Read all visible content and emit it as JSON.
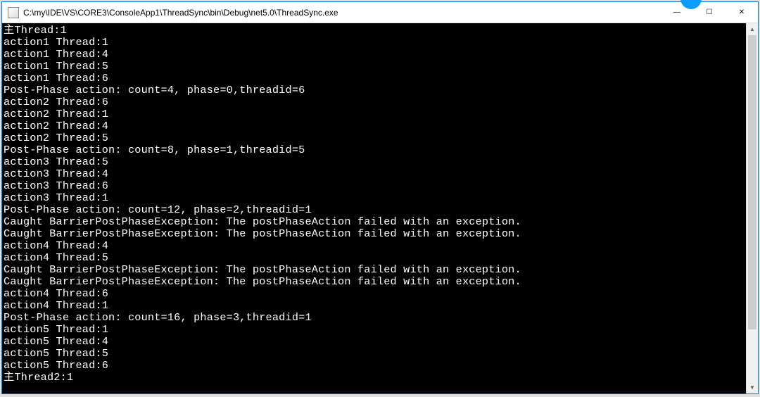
{
  "window": {
    "title": "C:\\my\\IDE\\VS\\CORE3\\ConsoleApp1\\ThreadSync\\bin\\Debug\\net5.0\\ThreadSync.exe"
  },
  "console": {
    "lines": [
      "主Thread:1",
      "action1 Thread:1",
      "action1 Thread:4",
      "action1 Thread:5",
      "action1 Thread:6",
      "Post-Phase action: count=4, phase=0,threadid=6",
      "action2 Thread:6",
      "action2 Thread:1",
      "action2 Thread:4",
      "action2 Thread:5",
      "Post-Phase action: count=8, phase=1,threadid=5",
      "action3 Thread:5",
      "action3 Thread:4",
      "action3 Thread:6",
      "action3 Thread:1",
      "Post-Phase action: count=12, phase=2,threadid=1",
      "Caught BarrierPostPhaseException: The postPhaseAction failed with an exception.",
      "Caught BarrierPostPhaseException: The postPhaseAction failed with an exception.",
      "action4 Thread:4",
      "action4 Thread:5",
      "Caught BarrierPostPhaseException: The postPhaseAction failed with an exception.",
      "Caught BarrierPostPhaseException: The postPhaseAction failed with an exception.",
      "action4 Thread:6",
      "action4 Thread:1",
      "Post-Phase action: count=16, phase=3,threadid=1",
      "action5 Thread:1",
      "action5 Thread:4",
      "action5 Thread:5",
      "action5 Thread:6",
      "主Thread2:1"
    ]
  },
  "titlebar_controls": {
    "minimize": "—",
    "maximize": "☐",
    "close": "✕"
  },
  "scrollbar": {
    "up": "▲",
    "down": "▼"
  }
}
